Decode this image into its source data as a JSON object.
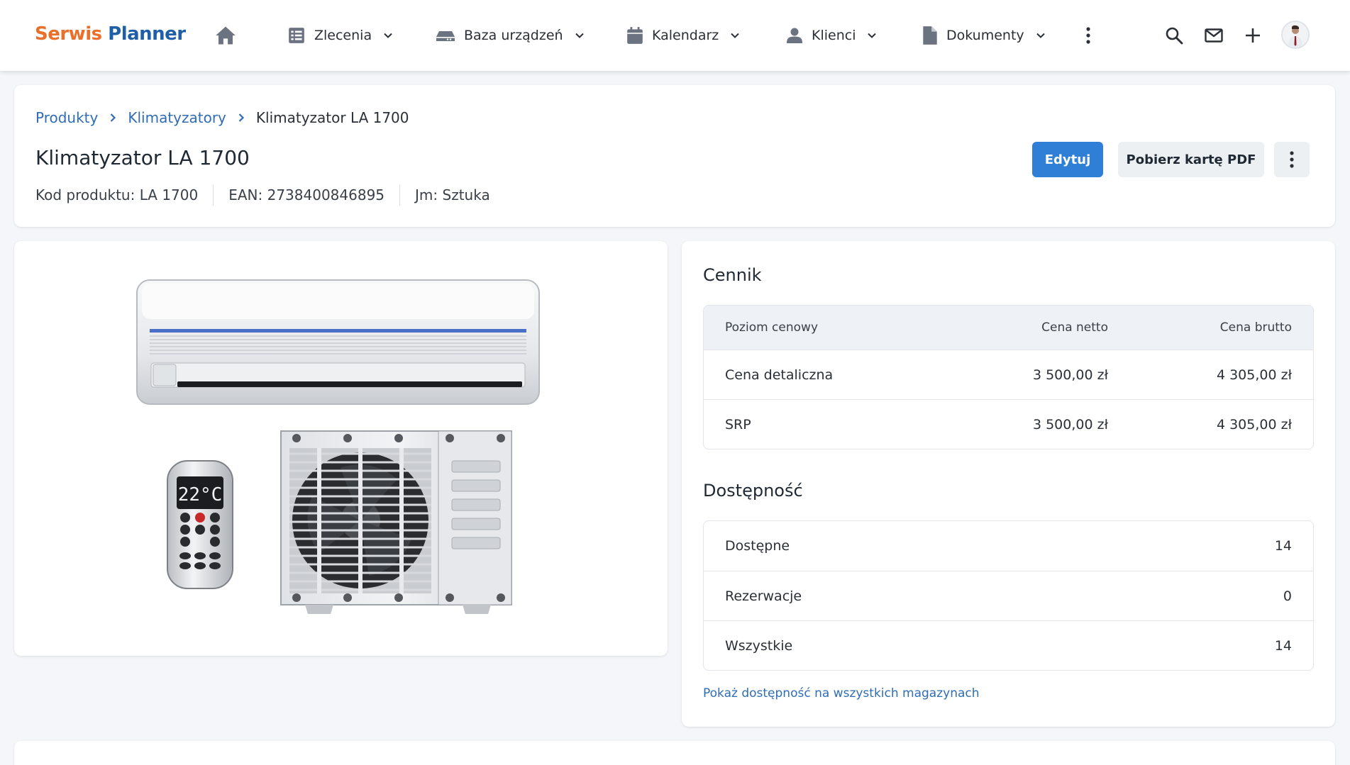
{
  "app": {
    "logo_part1": "Serwis",
    "logo_part2": " Planner"
  },
  "nav": {
    "items": [
      {
        "label": "Zlecenia",
        "icon": "list-icon"
      },
      {
        "label": "Baza urządzeń",
        "icon": "device-icon"
      },
      {
        "label": "Kalendarz",
        "icon": "calendar-icon"
      },
      {
        "label": "Klienci",
        "icon": "person-icon"
      },
      {
        "label": "Dokumenty",
        "icon": "document-icon"
      }
    ]
  },
  "breadcrumb": {
    "items": [
      "Produkty",
      "Klimatyzatory",
      "Klimatyzator LA 1700"
    ]
  },
  "product": {
    "title": "Klimatyzator LA 1700",
    "code": "Kod produktu: LA 1700",
    "ean": "EAN: 2738400846895",
    "unit": "Jm: Sztuka",
    "remote_display": "22°C"
  },
  "actions": {
    "edit_label": "Edytuj",
    "pdf_label": "Pobierz kartę PDF"
  },
  "pricing": {
    "title": "Cennik",
    "headers": [
      "Poziom cenowy",
      "Cena netto",
      "Cena brutto"
    ],
    "rows": [
      {
        "level": "Cena detaliczna",
        "net": "3 500,00 zł",
        "gross": "4 305,00 zł"
      },
      {
        "level": "SRP",
        "net": "3 500,00 zł",
        "gross": "4 305,00 zł"
      }
    ]
  },
  "availability": {
    "title": "Dostępność",
    "rows": [
      {
        "label": "Dostępne",
        "value": "14"
      },
      {
        "label": "Rezerwacje",
        "value": "0"
      },
      {
        "label": "Wszystkie",
        "value": "14"
      }
    ],
    "show_all_label": "Pokaż dostępność na wszystkich magazynach"
  },
  "colors": {
    "accent": "#2f7fd6",
    "logo_orange": "#e8702a",
    "logo_blue": "#1f5fa8",
    "link": "#2f6db5"
  }
}
